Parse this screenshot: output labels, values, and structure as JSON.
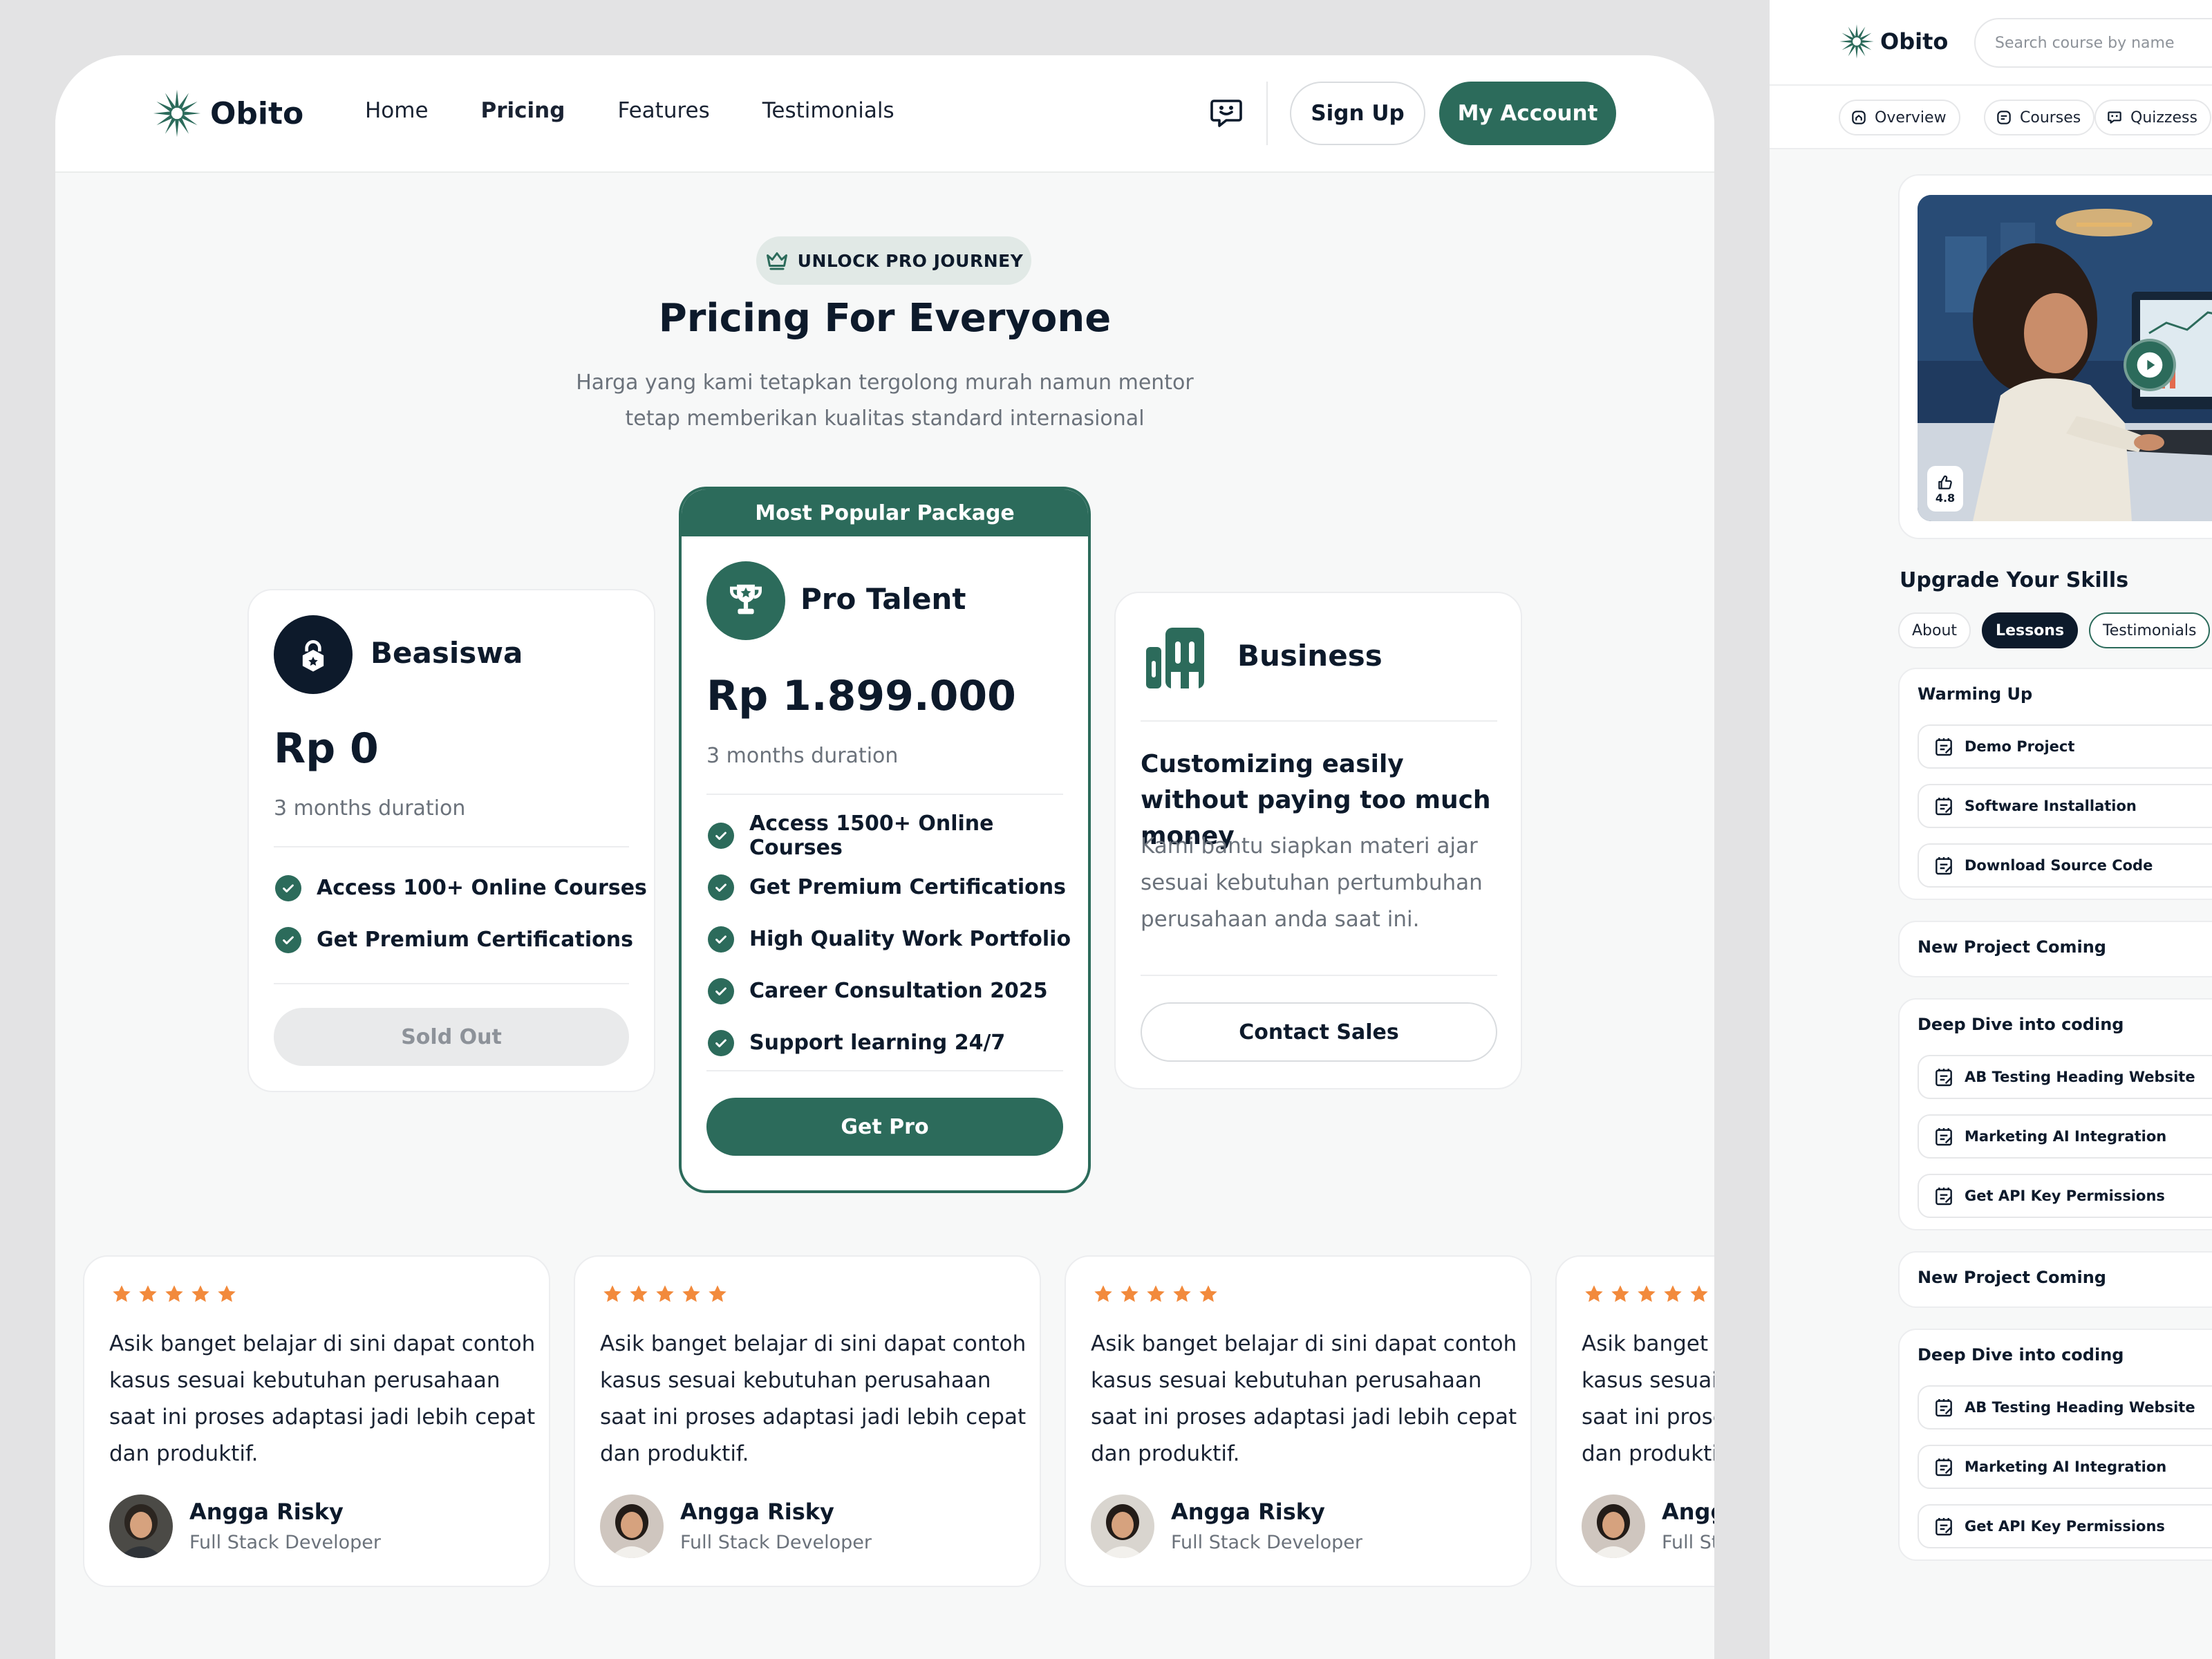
{
  "brand": {
    "name": "Obito",
    "color": "#2c6b5b",
    "dark": "#0d1a2b"
  },
  "nav": {
    "links": [
      "Home",
      "Pricing",
      "Features",
      "Testimonials"
    ],
    "active": "Pricing",
    "signup": "Sign Up",
    "account": "My Account",
    "chat_icon": "chat-bubble-icon"
  },
  "hero": {
    "badge": "UNLOCK PRO JOURNEY",
    "title": "Pricing For Everyone",
    "subtitle_line1": "Harga yang kami tetapkan tergolong murah namun mentor",
    "subtitle_line2": "tetap memberikan kualitas standard internasional"
  },
  "plans": [
    {
      "name": "Beasiswa",
      "price": "Rp 0",
      "duration": "3 months duration",
      "features": [
        "Access 100+ Online Courses",
        "Get Premium Certifications"
      ],
      "button": "Sold Out",
      "icon": "lock-icon"
    },
    {
      "ribbon": "Most Popular Package",
      "name": "Pro Talent",
      "price": "Rp 1.899.000",
      "duration": "3 months duration",
      "features": [
        "Access 1500+ Online Courses",
        "Get Premium Certifications",
        "High Quality Work Portfolio",
        "Career Consultation 2025",
        "Support learning 24/7"
      ],
      "button": "Get Pro",
      "icon": "trophy-icon"
    },
    {
      "name": "Business",
      "headline": "Customizing easily without paying too much money",
      "description": "Kami bantu siapkan materi ajar sesuai kebutuhan pertumbuhan perusahaan anda saat ini.",
      "button": "Contact Sales",
      "icon": "building-icon"
    }
  ],
  "testimonials": [
    {
      "rating": 5,
      "text": "Asik banget belajar di sini dapat contoh kasus sesuai kebutuhan perusahaan saat ini proses adaptasi jadi lebih cepat dan produktif.",
      "name": "Angga Risky",
      "role": "Full Stack Developer"
    },
    {
      "rating": 5,
      "text": "Asik banget belajar di sini dapat contoh kasus sesuai kebutuhan perusahaan saat ini proses adaptasi jadi lebih cepat dan produktif.",
      "name": "Angga Risky",
      "role": "Full Stack Developer"
    },
    {
      "rating": 5,
      "text": "Asik banget belajar di sini dapat contoh kasus sesuai kebutuhan perusahaan saat ini proses adaptasi jadi lebih cepat dan produktif.",
      "name": "Angga Risky",
      "role": "Full Stack Developer"
    },
    {
      "rating": 5,
      "text": "Asik banget belajar di sini dapat contoh kasus sesuai kebutuhan perusahaan saat ini proses adaptasi jadi lebih cepat dan produktif.",
      "name": "Angga Risky",
      "role": "Full Stack Developer"
    }
  ],
  "side": {
    "logo": "Obito",
    "search_placeholder": "Search course by name",
    "tabs": [
      "Overview",
      "Courses",
      "Quizzess"
    ],
    "rating": "4.8",
    "heading": "Upgrade Your Skills",
    "pill_tabs": [
      "About",
      "Lessons",
      "Testimonials"
    ],
    "selected_tab": "Lessons",
    "sections": [
      {
        "title": "Warming Up",
        "lessons": [
          "Demo Project",
          "Software Installation",
          "Download Source Code"
        ]
      },
      {
        "title": "New Project Coming",
        "lessons": []
      },
      {
        "title": "Deep Dive into coding",
        "lessons": [
          "AB Testing Heading Website",
          "Marketing AI Integration",
          "Get API Key Permissions"
        ]
      },
      {
        "title": "New Project Coming",
        "lessons": []
      },
      {
        "title": "Deep Dive into coding",
        "lessons": [
          "AB Testing Heading Website",
          "Marketing AI Integration",
          "Get API Key Permissions"
        ]
      }
    ]
  }
}
